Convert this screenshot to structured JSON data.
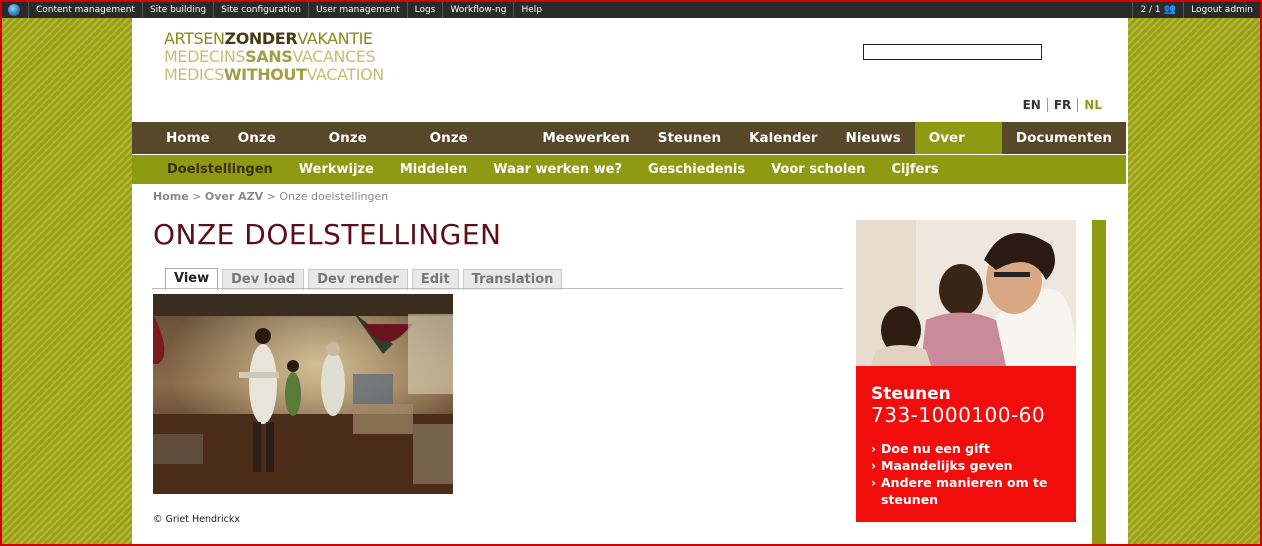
{
  "admin_bar": {
    "items": [
      "Content management",
      "Site building",
      "Site configuration",
      "User management",
      "Logs",
      "Workflow-ng",
      "Help"
    ],
    "counter": "2 / 1",
    "logout": "Logout admin"
  },
  "logo": {
    "line1": [
      "ARTSEN",
      "ZONDER",
      "VAKANTIE"
    ],
    "line2": [
      "MEDECINS",
      "SANS",
      "VACANCES"
    ],
    "line3": [
      "MEDICS",
      "WITHOUT",
      "VACATION"
    ]
  },
  "search": {
    "value": ""
  },
  "languages": {
    "items": [
      "EN",
      "FR",
      "NL"
    ],
    "active": "NL"
  },
  "main_nav": {
    "items": [
      "Home",
      "Onze blog",
      "Onze acties",
      "Onze mensen",
      "Meewerken",
      "Steunen",
      "Kalender",
      "Nieuws",
      "Over AZV",
      "Documenten"
    ],
    "active": "Over AZV"
  },
  "sub_nav": {
    "items": [
      "Doelstellingen",
      "Werkwijze",
      "Middelen",
      "Waar werken we?",
      "Geschiedenis",
      "Voor scholen",
      "Cijfers"
    ],
    "active": "Doelstellingen"
  },
  "breadcrumb": {
    "home": "Home",
    "sep1": ">",
    "section": "Over AZV",
    "sep2": ">",
    "current": "Onze doelstellingen"
  },
  "page_title": "ONZE DOELSTELLINGEN",
  "tabs": {
    "items": [
      "View",
      "Dev load",
      "Dev render",
      "Edit",
      "Translation"
    ],
    "active": "View"
  },
  "photo_credit": "© Griet Hendrickx",
  "donate": {
    "title": "Steunen",
    "number": "733-1000100-60",
    "links": [
      "Doe nu een gift",
      "Maandelijks geven",
      "Andere manieren om te steunen"
    ]
  },
  "colors": {
    "olive": "#8e9b12",
    "nav_brown": "#57482a",
    "title_red": "#5a0f19",
    "donate_red": "#f20d0d"
  }
}
